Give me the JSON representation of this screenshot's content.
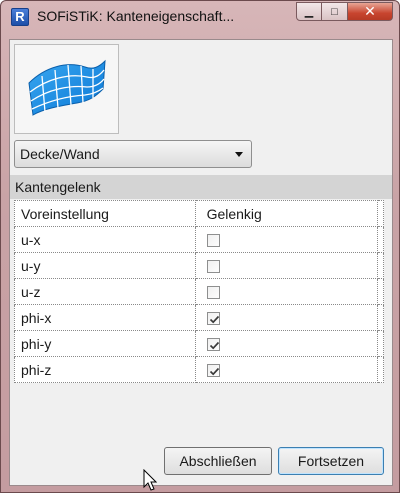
{
  "window": {
    "logo_letter": "R",
    "title": "SOFiSTiK: Kanteneigenschaft...",
    "minimize_glyph": "▁",
    "maximize_glyph": "□",
    "close_glyph": "✕"
  },
  "preview": {
    "icon": "surface-mesh-icon"
  },
  "type_select": {
    "selected": "Decke/Wand"
  },
  "section": {
    "title": "Kantengelenk"
  },
  "grid": {
    "header": {
      "col1": "Voreinstellung",
      "col2": "Gelenkig"
    },
    "rows": [
      {
        "label": "u-x",
        "checked": false
      },
      {
        "label": "u-y",
        "checked": false
      },
      {
        "label": "u-z",
        "checked": false
      },
      {
        "label": "phi-x",
        "checked": true
      },
      {
        "label": "phi-y",
        "checked": true
      },
      {
        "label": "phi-z",
        "checked": true
      }
    ]
  },
  "buttons": {
    "cancel": "Abschließen",
    "ok": "Fortsetzen"
  },
  "colors": {
    "surface": "#1e90e6",
    "title_bar": "#c9a3a6",
    "close_button": "#c8452f"
  }
}
